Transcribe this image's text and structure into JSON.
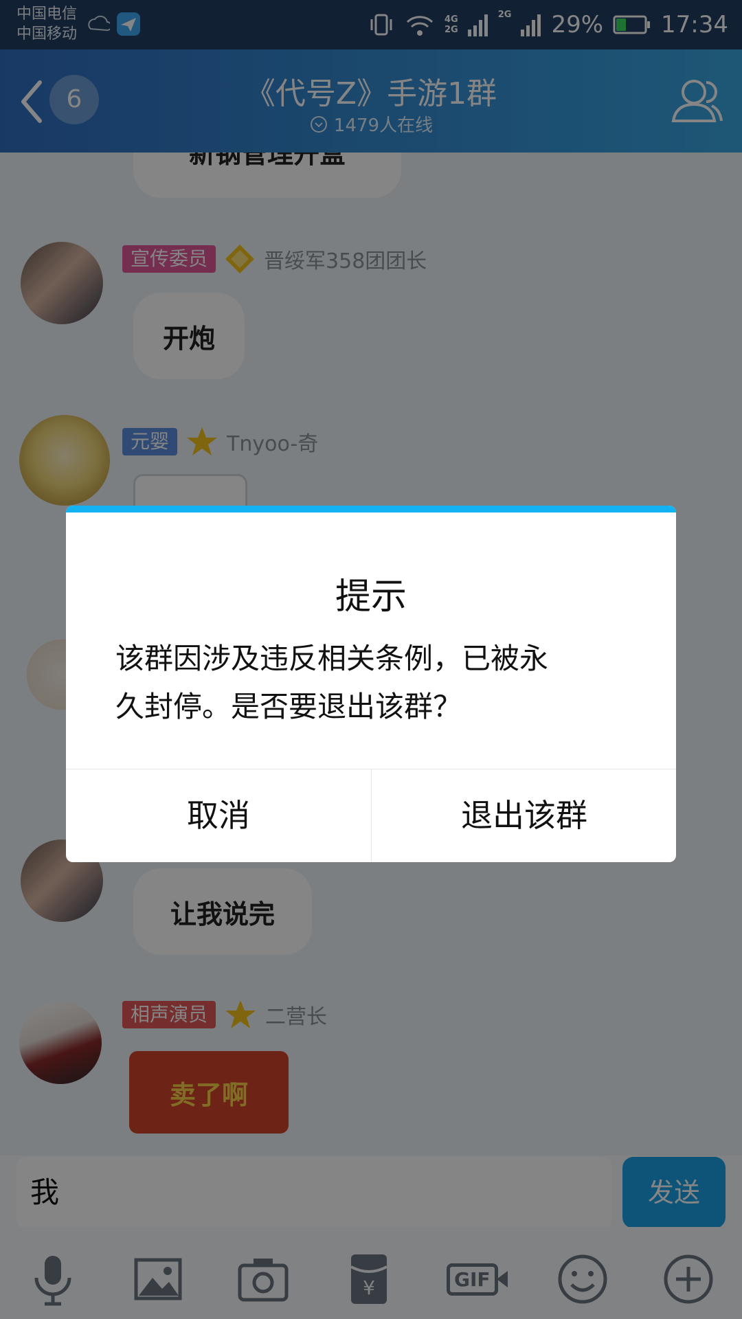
{
  "status_bar": {
    "carrier1": "中国电信",
    "carrier2": "中国移动",
    "net1": "4G",
    "net2": "2G",
    "net3": "2G",
    "battery": "29%",
    "time": "17:34"
  },
  "header": {
    "back_count": "6",
    "title": "《代号Z》手游1群",
    "online": "1479人在线"
  },
  "messages": [
    {
      "text": "新钢管理开盒"
    },
    {
      "tag": "宣传委员",
      "tag_color": "#e2589a",
      "nick": "晋绥军358团团长",
      "text": "开炮"
    },
    {
      "tag": "元婴",
      "tag_color": "#5a8fe0",
      "nick": "Tnyoo-奇"
    },
    {
      "text": "让我说完"
    },
    {
      "tag": "相声演员",
      "tag_color": "#e05656",
      "nick": "二营长",
      "sticker": "卖了啊"
    }
  ],
  "input": {
    "value": "我",
    "send_label": "发送"
  },
  "toolbar": {
    "icons": [
      "microphone-icon",
      "image-icon",
      "camera-icon",
      "red-packet-icon",
      "gif-icon",
      "emoji-icon",
      "plus-icon"
    ],
    "gif_label": "GIF"
  },
  "dialog": {
    "title": "提示",
    "message_line1": "该群因涉及违反相关条例，已被永",
    "message_line2": "久封停。是否要退出该群？",
    "cancel_label": "取消",
    "confirm_label": "退出该群",
    "accent_color": "#12b3f1"
  }
}
